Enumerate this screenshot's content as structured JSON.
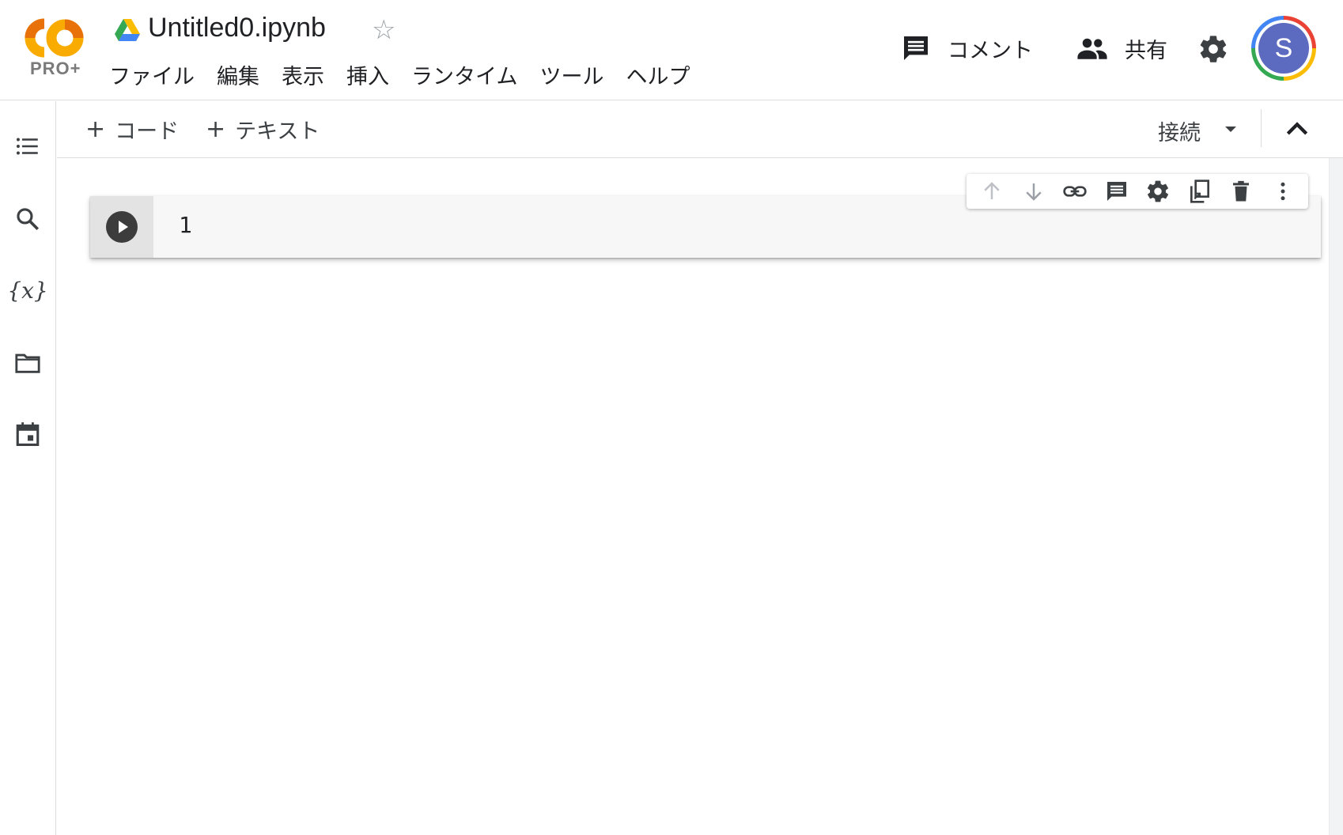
{
  "header": {
    "logo_text": "CO",
    "plan_badge": "PRO+",
    "doc_title": "Untitled0.ipynb",
    "menu": [
      "ファイル",
      "編集",
      "表示",
      "挿入",
      "ランタイム",
      "ツール",
      "ヘルプ"
    ],
    "comment_label": "コメント",
    "share_label": "共有",
    "avatar_initial": "S"
  },
  "toolbar": {
    "add_code_plus": "+",
    "add_code_label": "コード",
    "add_text_plus": "+",
    "add_text_label": "テキスト",
    "connect_label": "接続"
  },
  "cell": {
    "line_number": "1"
  },
  "colors": {
    "accent_orange": "#e8710a",
    "logo_yellow": "#f9ab00",
    "avatar_bg": "#5c6bc0",
    "divider": "#dadce0"
  },
  "icons": {
    "rail": [
      "toc-icon",
      "search-icon",
      "variables-icon",
      "folder-icon",
      "calendar-icon"
    ],
    "cell_toolbar": [
      "arrow-up-icon",
      "arrow-down-icon",
      "link-icon",
      "comment-icon",
      "gear-icon",
      "mirror-cell-icon",
      "trash-icon",
      "more-vert-icon"
    ]
  },
  "rail": {
    "variables_glyph": "{x}"
  }
}
